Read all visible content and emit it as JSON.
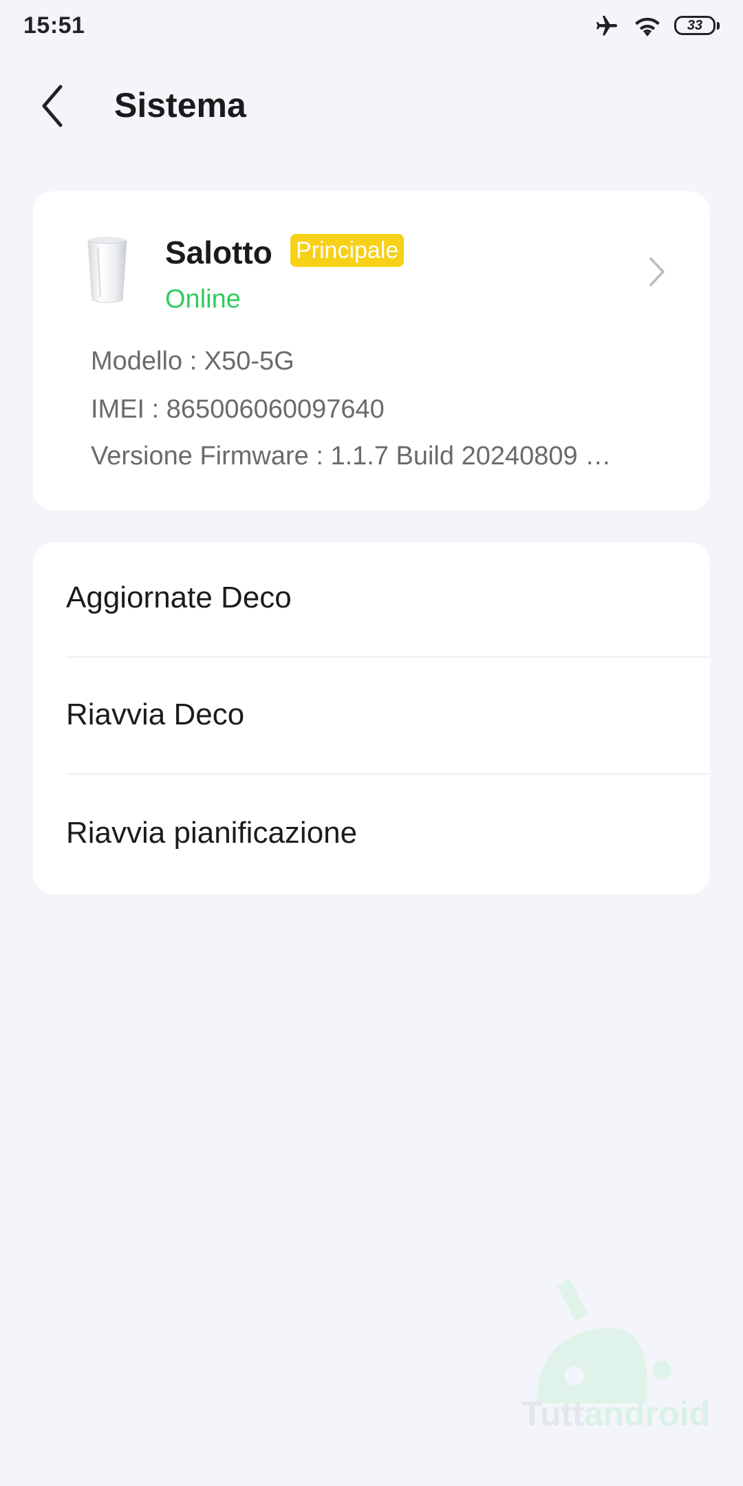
{
  "status_bar": {
    "time": "15:51",
    "battery_level": "33",
    "icons": [
      "airplane-icon",
      "wifi-icon",
      "battery-icon"
    ]
  },
  "header": {
    "title": "Sistema",
    "back_icon": "chevron-left-icon"
  },
  "device": {
    "name": "Salotto",
    "badge": "Principale",
    "status": "Online",
    "model": "Modello : X50-5G",
    "imei": "IMEI : 865006060097640",
    "firmware": "Versione Firmware : 1.1.7 Build 20240809 …",
    "image": "deco-router-icon"
  },
  "actions": [
    {
      "label": "Aggiornate Deco"
    },
    {
      "label": "Riavvia Deco"
    },
    {
      "label": "Riavvia pianificazione"
    }
  ],
  "watermark": {
    "brand_part1": "Tutt",
    "brand_part2": "android"
  },
  "colors": {
    "background": "#f4f5fa",
    "card": "#ffffff",
    "badge": "#f7d018",
    "online": "#2ecc5e"
  }
}
